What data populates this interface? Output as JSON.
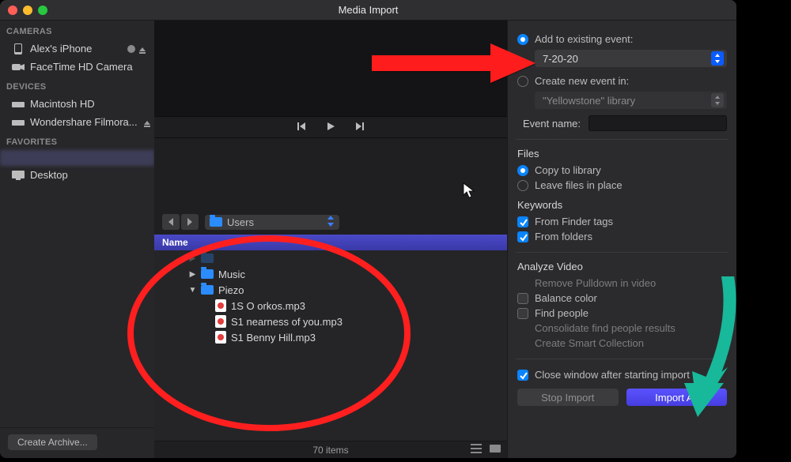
{
  "window": {
    "title": "Media Import"
  },
  "sidebar": {
    "sections": {
      "cameras": "CAMERAS",
      "devices": "DEVICES",
      "favorites": "FAVORITES"
    },
    "items": {
      "iphone": "Alex's iPhone",
      "facetime": "FaceTime HD Camera",
      "mac_hd": "Macintosh HD",
      "wondershare": "Wondershare Filmora...",
      "desktop": "Desktop"
    },
    "footer_btn": "Create Archive..."
  },
  "path_bar": {
    "current": "Users"
  },
  "list": {
    "header": "Name"
  },
  "files": {
    "music": "Music",
    "piezo": "Piezo",
    "f1": "1S O orkos.mp3",
    "f2": "S1 nearness of you.mp3",
    "f3": "S1 Benny Hill.mp3"
  },
  "status": {
    "count": "70 items"
  },
  "right": {
    "add_existing": "Add to existing event:",
    "event_selected": "7-20-20",
    "create_new": "Create new event in:",
    "library_selected": "\"Yellowstone\" library",
    "event_name_label": "Event name:",
    "files_title": "Files",
    "copy_library": "Copy to library",
    "leave_files": "Leave files in place",
    "keywords_title": "Keywords",
    "from_finder": "From Finder tags",
    "from_folders": "From folders",
    "analyze_title": "Analyze Video",
    "remove_pulldown": "Remove Pulldown in video",
    "balance_color": "Balance color",
    "find_people": "Find people",
    "consolidate": "Consolidate find people results",
    "smart_collection": "Create Smart Collection",
    "close_after": "Close window after starting import",
    "stop_btn": "Stop Import",
    "import_btn": "Import All"
  }
}
